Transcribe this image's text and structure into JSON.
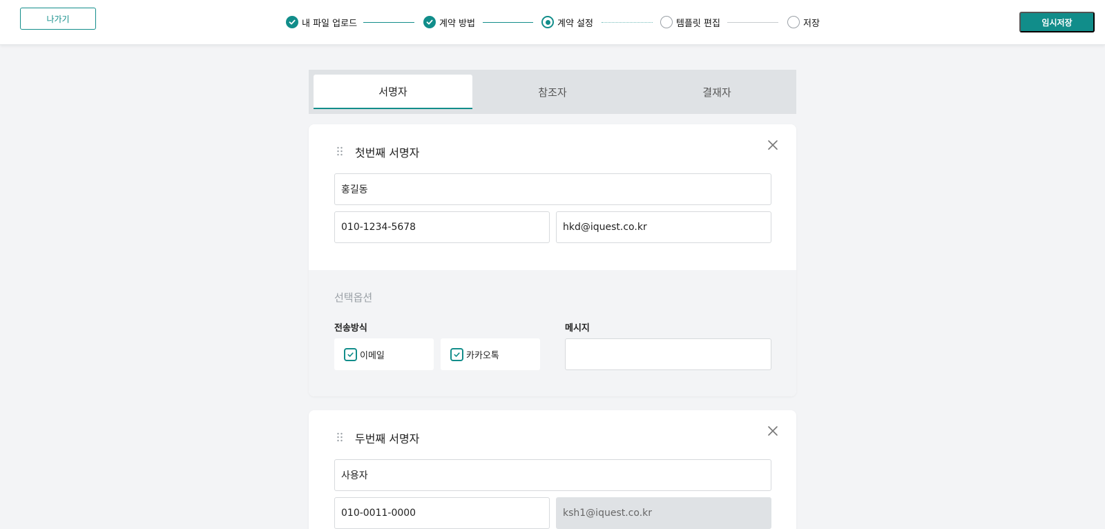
{
  "header": {
    "exit_label": "나가기",
    "save_label": "임시저장",
    "steps": [
      {
        "label": "내 파일 업로드",
        "status": "done"
      },
      {
        "label": "계약 방법",
        "status": "done"
      },
      {
        "label": "계약 설정",
        "status": "current"
      },
      {
        "label": "템플릿 편집",
        "status": "todo"
      },
      {
        "label": "저장",
        "status": "todo"
      }
    ]
  },
  "tabs": [
    {
      "label": "서명자",
      "active": true
    },
    {
      "label": "참조자",
      "active": false
    },
    {
      "label": "결재자",
      "active": false
    }
  ],
  "signers": [
    {
      "title": "첫번째 서명자",
      "name": "홍길동",
      "phone": "010-1234-5678",
      "email": "hkd@iquest.co.kr",
      "email_disabled": false,
      "options": {
        "title": "선택옵션",
        "delivery_label": "전송방식",
        "delivery_methods": [
          {
            "label": "이메일",
            "checked": true
          },
          {
            "label": "카카오톡",
            "checked": true
          }
        ],
        "message_label": "메시지",
        "message_value": ""
      }
    },
    {
      "title": "두번째 서명자",
      "name": "사용자",
      "phone": "010-0011-0000",
      "email": "ksh1@iquest.co.kr",
      "email_disabled": true
    }
  ],
  "colors": {
    "accent": "#118d8a",
    "background": "#f3f4f6",
    "tab_bar": "#dfe2e5",
    "muted_text": "#9aa0a6"
  },
  "icons": [
    "check-icon",
    "drag-handle-icon",
    "close-icon",
    "checkbox-checked-icon"
  ]
}
